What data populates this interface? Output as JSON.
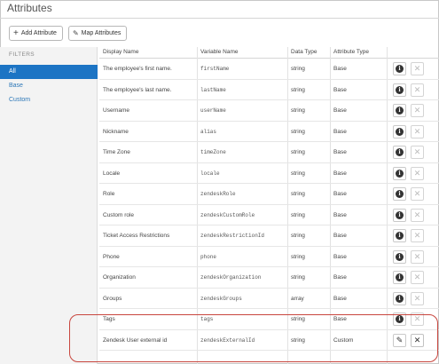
{
  "page": {
    "title": "Attributes"
  },
  "toolbar": {
    "add_label": "Add Attribute",
    "map_label": "Map Attributes",
    "add_icon": "plus-icon",
    "map_icon": "pencil-icon"
  },
  "sidebar": {
    "heading": "FILTERS",
    "items": [
      {
        "label": "All",
        "active": true
      },
      {
        "label": "Base",
        "active": false
      },
      {
        "label": "Custom",
        "active": false
      }
    ]
  },
  "table": {
    "columns": [
      "Display Name",
      "Variable Name",
      "Data Type",
      "Attribute Type"
    ],
    "rows": [
      {
        "display": "The employee's first name.",
        "variable": "firstName",
        "type": "string",
        "attr": "Base",
        "action_icon": "info-icon",
        "deletable": false
      },
      {
        "display": "The employee's last name.",
        "variable": "lastName",
        "type": "string",
        "attr": "Base",
        "action_icon": "info-icon",
        "deletable": false
      },
      {
        "display": "Username",
        "variable": "userName",
        "type": "string",
        "attr": "Base",
        "action_icon": "info-icon",
        "deletable": false
      },
      {
        "display": "Nickname",
        "variable": "alias",
        "type": "string",
        "attr": "Base",
        "action_icon": "info-icon",
        "deletable": false
      },
      {
        "display": "Time Zone",
        "variable": "timeZone",
        "type": "string",
        "attr": "Base",
        "action_icon": "info-icon",
        "deletable": false
      },
      {
        "display": "Locale",
        "variable": "locale",
        "type": "string",
        "attr": "Base",
        "action_icon": "info-icon",
        "deletable": false
      },
      {
        "display": "Role",
        "variable": "zendeskRole",
        "type": "string",
        "attr": "Base",
        "action_icon": "info-icon",
        "deletable": false
      },
      {
        "display": "Custom role",
        "variable": "zendeskCustomRole",
        "type": "string",
        "attr": "Base",
        "action_icon": "info-icon",
        "deletable": false
      },
      {
        "display": "Ticket Access Restrictions",
        "variable": "zendeskRestrictionId",
        "type": "string",
        "attr": "Base",
        "action_icon": "info-icon",
        "deletable": false
      },
      {
        "display": "Phone",
        "variable": "phone",
        "type": "string",
        "attr": "Base",
        "action_icon": "info-icon",
        "deletable": false
      },
      {
        "display": "Organization",
        "variable": "zendeskOrganization",
        "type": "string",
        "attr": "Base",
        "action_icon": "info-icon",
        "deletable": false
      },
      {
        "display": "Groups",
        "variable": "zendeskGroups",
        "type": "array",
        "attr": "Base",
        "action_icon": "info-icon",
        "deletable": false
      },
      {
        "display": "Tags",
        "variable": "tags",
        "type": "string",
        "attr": "Base",
        "action_icon": "info-icon",
        "deletable": false
      },
      {
        "display": "Zendesk User external id",
        "variable": "zendeskExternalId",
        "type": "string",
        "attr": "Custom",
        "action_icon": "pencil-icon",
        "deletable": true
      }
    ]
  },
  "colors": {
    "accent": "#1c74c4",
    "highlight": "#c8463e"
  }
}
